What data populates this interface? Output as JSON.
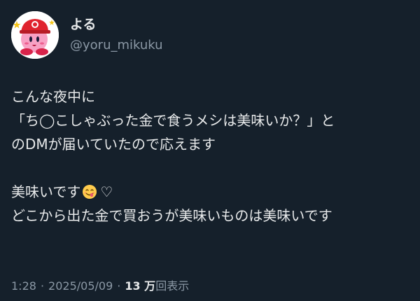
{
  "user": {
    "display_name": "よる",
    "handle": "@yoru_mikuku",
    "avatar_icon": "kirby-mario-cap-avatar-icon"
  },
  "tweet": {
    "lines": [
      "こんな夜中に",
      "「ち◯こしゃぶった金で食うメシは美味いか？」と",
      "のDMが届いていたので応えます",
      "",
      "美味いです",
      "どこから出た金で買おうが美味いものは美味いです"
    ],
    "emoji_icon": "yum-face-icon",
    "heart_glyph": "♡"
  },
  "meta": {
    "time": "1:28",
    "date": "2025/05/09",
    "views_count": "13 万",
    "views_label": "回表示",
    "separator": "·"
  },
  "colors": {
    "background": "#15202b",
    "text": "#e7e9ea",
    "secondary": "#8b98a5"
  }
}
